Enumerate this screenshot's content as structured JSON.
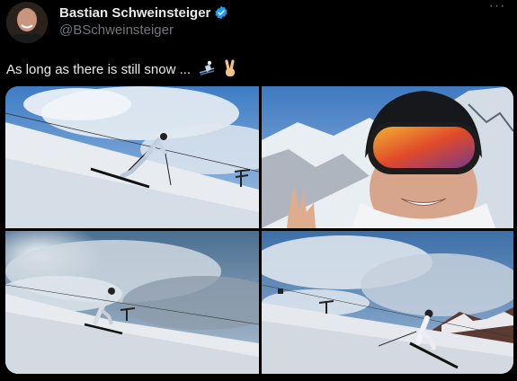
{
  "author": {
    "display_name": "Bastian Schweinsteiger",
    "handle": "@BSchweinsteiger",
    "verified": true,
    "avatar_icon": "profile-photo"
  },
  "tweet": {
    "text": "As long as there is still snow ...",
    "emojis": [
      "skier-emoji",
      "victory-hand-emoji"
    ]
  },
  "menu": {
    "more_label": "···"
  },
  "colors": {
    "background": "#000000",
    "primary_text": "#e7e9ea",
    "secondary_text": "#71767b",
    "verified": "#1d9bf0"
  },
  "media": [
    {
      "name": "skier-carving-slope"
    },
    {
      "name": "selfie-ski-goggles"
    },
    {
      "name": "skier-under-cloudy-sky"
    },
    {
      "name": "skier-near-chairlift"
    }
  ]
}
